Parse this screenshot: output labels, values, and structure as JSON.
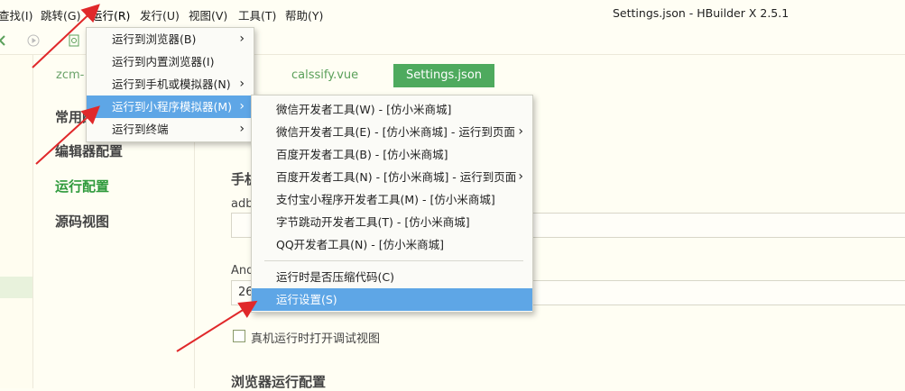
{
  "window_title": "Settings.json - HBuilder X 2.5.1",
  "menubar": {
    "items": [
      "查找(I)",
      "跳转(G)",
      "运行(R)",
      "发行(U)",
      "视图(V)",
      "工具(T)",
      "帮助(Y)"
    ]
  },
  "editor_tabs": {
    "tab1": "zcm-",
    "tab2": "calssify.vue",
    "tab3": "Settings.json"
  },
  "settings_nav": {
    "items": [
      "常用配置",
      "编辑器配置",
      "运行配置",
      "源码视图"
    ]
  },
  "content": {
    "phone_heading": "手机",
    "adb_label": "adb",
    "android_label": "And",
    "port_value": "26",
    "checkbox_label": "真机运行时打开调试视图",
    "browser_heading": "浏览器运行配置"
  },
  "run_menu": {
    "items": [
      "运行到浏览器(B)",
      "运行到内置浏览器(I)",
      "运行到手机或模拟器(N)",
      "运行到小程序模拟器(M)",
      "运行到终端"
    ]
  },
  "submenu": {
    "items": [
      "微信开发者工具(W) - [仿小米商城]",
      "微信开发者工具(E) - [仿小米商城] - 运行到页面",
      "百度开发者工具(B) - [仿小米商城]",
      "百度开发者工具(N) - [仿小米商城] - 运行到页面",
      "支付宝小程序开发者工具(M) - [仿小米商城]",
      "字节跳动开发者工具(T) - [仿小米商城]",
      "QQ开发者工具(N) - [仿小米商城]"
    ],
    "compress_label": "运行时是否压缩代码(C)",
    "settings_label": "运行设置(S)"
  },
  "colors": {
    "accent_green": "#4eaa5e",
    "menu_highlight": "#5ea6e6",
    "annotation_red": "#e0282a"
  }
}
